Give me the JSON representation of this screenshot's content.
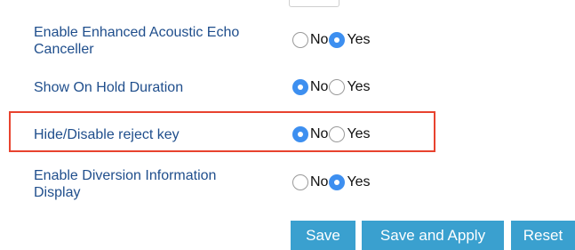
{
  "settings": [
    {
      "label": "Enable Enhanced Acoustic Echo Canceller",
      "options": [
        "No",
        "Yes"
      ],
      "selected": "Yes"
    },
    {
      "label": "Show On Hold Duration",
      "options": [
        "No",
        "Yes"
      ],
      "selected": "No"
    },
    {
      "label": "Hide/Disable reject key",
      "options": [
        "No",
        "Yes"
      ],
      "selected": "No",
      "highlighted": true
    },
    {
      "label": "Enable Diversion Information Display",
      "options": [
        "No",
        "Yes"
      ],
      "selected": "Yes"
    }
  ],
  "buttons": {
    "save": "Save",
    "save_and_apply": "Save and Apply",
    "reset": "Reset"
  },
  "colors": {
    "label_text": "#1f4e8c",
    "radio_selected": "#3d8ff0",
    "highlight_border": "#e8432f",
    "button_bg": "#3aa0cf"
  }
}
